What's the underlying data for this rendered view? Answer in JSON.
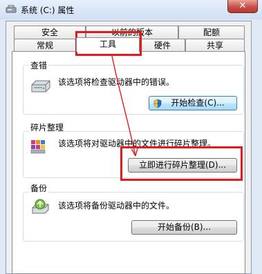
{
  "window": {
    "title": "系统 (C:) 属性",
    "close_glyph": "✕"
  },
  "tabs": {
    "row_top": [
      "安全",
      "以前的版本",
      "配额"
    ],
    "row_bottom": [
      "常规",
      "工具",
      "硬件",
      "共享"
    ],
    "active": "工具"
  },
  "sections": {
    "error_check": {
      "label": "查错",
      "description": "该选项将检查驱动器中的错误。",
      "button": "开始检查(C)..."
    },
    "defrag": {
      "label": "碎片整理",
      "description": "该选项将对驱动器中的文件进行碎片整理。",
      "button": "立即进行碎片整理(D)..."
    },
    "backup": {
      "label": "备份",
      "description": "该选项将备份驱动器中的文件。",
      "button": "开始备份(B)..."
    }
  },
  "colors": {
    "annotation": "#e01b1b",
    "focus_button_border": "#3c7fb1"
  },
  "icons": [
    "drive-properties-icon",
    "close-icon",
    "hard-drive-icon",
    "shield-icon",
    "defrag-icon",
    "backup-icon"
  ]
}
